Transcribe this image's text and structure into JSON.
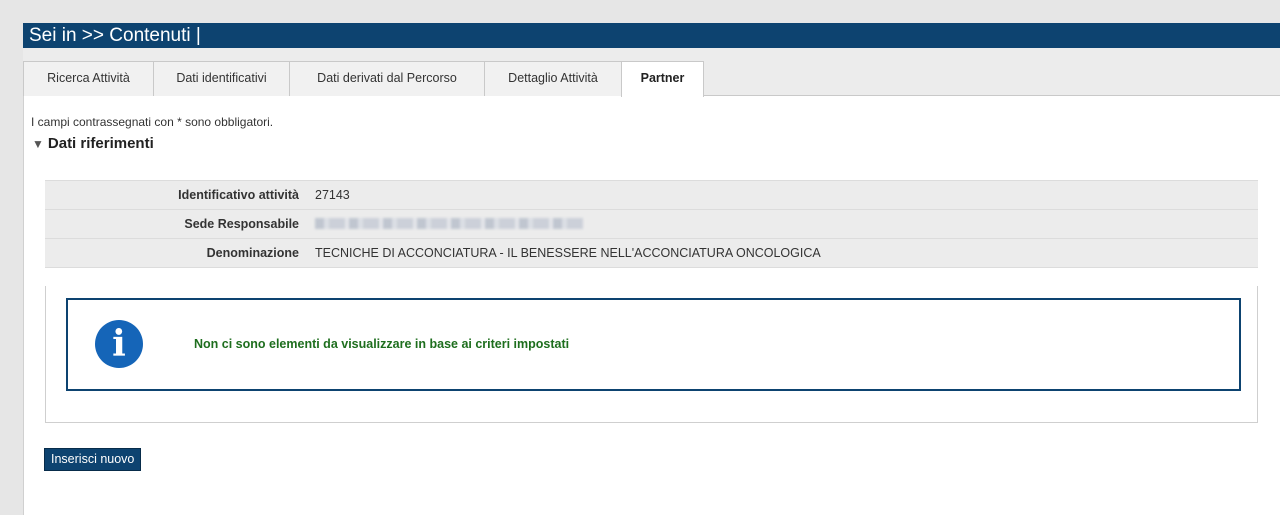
{
  "header": {
    "title": "Sei in >> Contenuti |"
  },
  "tabs": [
    {
      "label": "Ricerca Attività"
    },
    {
      "label": "Dati identificativi"
    },
    {
      "label": "Dati derivati dal Percorso"
    },
    {
      "label": "Dettaglio Attività"
    },
    {
      "label": "Partner"
    }
  ],
  "active_tab": "Partner",
  "form": {
    "required_note": "I campi contrassegnati con * sono obbligatori.",
    "section_title": "Dati riferimenti",
    "fields": [
      {
        "label": "Identificativo attività",
        "value": "27143"
      },
      {
        "label": "Sede Responsabile",
        "value": ""
      },
      {
        "label": "Denominazione",
        "value": "TECNICHE DI ACCONCIATURA - IL BENESSERE NELL'ACCONCIATURA ONCOLOGICA"
      }
    ]
  },
  "message": {
    "text": "Non ci sono elementi da visualizzare in base ai criteri impostati"
  },
  "actions": {
    "insert_label": "Inserisci nuovo"
  },
  "colors": {
    "header": "#0d4370",
    "button": "#0d4370",
    "info_icon": "#1565b8",
    "message_text": "#1e6e1e"
  },
  "icons": {
    "info": "info-icon",
    "section_toggle": "triangle-down-icon"
  }
}
